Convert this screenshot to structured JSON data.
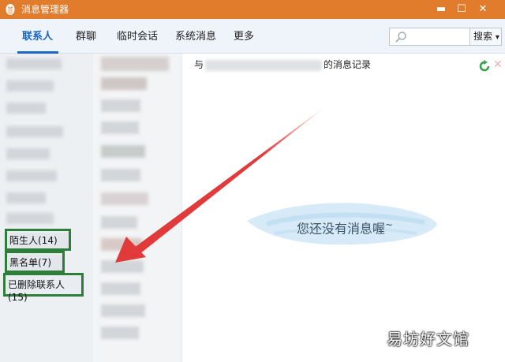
{
  "window": {
    "title": "消息管理器",
    "minimize_glyph": "▬",
    "maximize_glyph": "☐",
    "close_glyph": "✕",
    "accent_color": "#e07c2c"
  },
  "tabs": [
    {
      "label": "联系人",
      "active": true
    },
    {
      "label": "群聊",
      "active": false
    },
    {
      "label": "临时会话",
      "active": false
    },
    {
      "label": "系统消息",
      "active": false
    },
    {
      "label": "更多",
      "active": false
    }
  ],
  "search": {
    "placeholder": "",
    "button_label": "搜索",
    "dropdown_glyph": "▾"
  },
  "groups": [
    {
      "label": "陌生人(14)"
    },
    {
      "label": "黑名单(7)"
    },
    {
      "label": "已删除联系人(15)"
    }
  ],
  "chat": {
    "header_prefix": "与",
    "header_suffix": "的消息记录",
    "empty_message": "您还没有消息喔",
    "empty_tilde": "~"
  },
  "watermark": "易坊好文馆",
  "colors": {
    "active_tab": "#1a66c2",
    "highlight_box": "#2f7d3a",
    "arrow": "#e23a3a"
  }
}
